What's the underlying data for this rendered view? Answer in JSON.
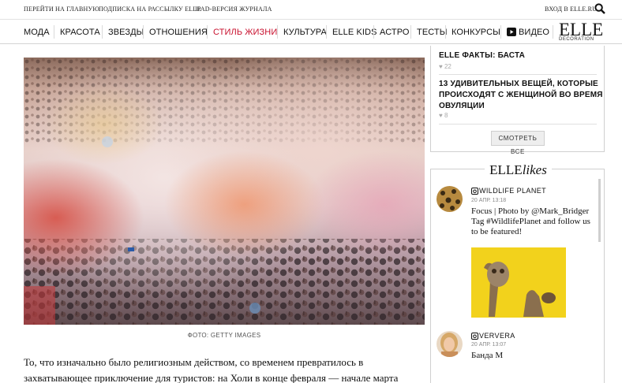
{
  "topbar": {
    "link_home": "ПЕРЕЙТИ НА ГЛАВНУЮ",
    "link_subscribe": "ПОДПИСКА НА РАССЫЛКУ ELLE",
    "link_ipad": "IPAD-ВЕРСИЯ ЖУРНАЛА",
    "login": "ВХОД В ELLE.RU",
    "search_icon": "search-icon"
  },
  "nav": {
    "items": [
      "МОДА",
      "КРАСОТА",
      "ЗВЕЗДЫ",
      "ОТНОШЕНИЯ",
      "СТИЛЬ ЖИЗНИ",
      "КУЛЬТУРА",
      "ELLE KIDS",
      "АСТРО",
      "ТЕСТЫ",
      "КОНКУРСЫ",
      "ВИДЕО"
    ],
    "active_index": 4,
    "active_color": "#c8102e",
    "video_icon": "play-icon"
  },
  "logo": {
    "word": "ELLE",
    "sub": "DECORATION"
  },
  "article": {
    "photo_caption": "ФОТО: GETTY IMAGES",
    "body_lines": [
      "То, что изначально было религиозным действом, со временем превратилось в",
      "захватывающее приключение для туристов: на Холи в конце февраля — начале марта"
    ]
  },
  "sidebar": {
    "popular": [
      {
        "title": "ELLE ФАКТЫ: БАСТА",
        "likes": "22"
      },
      {
        "title_lines": [
          "13 УДИВИТЕЛЬНЫХ ВЕЩЕЙ, КОТОРЫЕ",
          "ПРОИСХОДЯТ С ЖЕНЩИНОЙ ВО ВРЕМЯ",
          "ОВУЛЯЦИИ"
        ],
        "likes": "8"
      }
    ],
    "see_all": "СМОТРЕТЬ ВСЕ",
    "likes_block": {
      "logo_main": "ELLE",
      "logo_italic": "likes",
      "posts": [
        {
          "username": "WILDLIFE PLANET",
          "time": "20 АПР. 13:18",
          "text_lines": [
            "Focus | Photo by @Mark_Bridger",
            "Tag #WildlifePlanet and follow us",
            "to be featured!"
          ]
        },
        {
          "username": "VERVERA",
          "time": "20 АПР. 13:07",
          "text_lines": [
            "Банда М"
          ]
        }
      ]
    }
  }
}
